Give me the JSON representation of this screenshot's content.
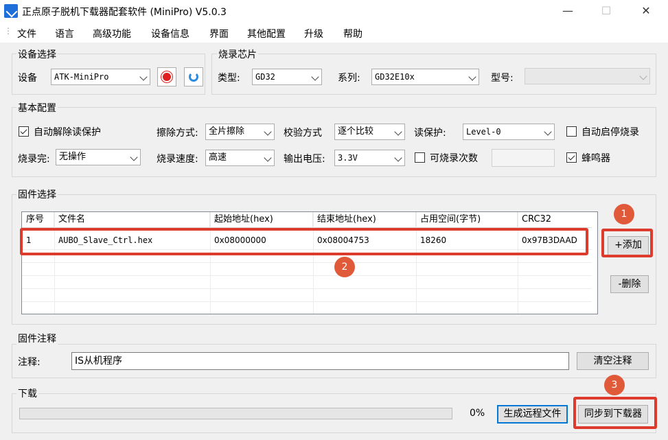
{
  "window": {
    "title": "正点原子脱机下载器配套软件 (MiniPro)  V5.0.3",
    "minimize": "—",
    "maximize": "☐",
    "close": "✕"
  },
  "menu": [
    "文件",
    "语言",
    "高级功能",
    "设备信息",
    "界面",
    "其他配置",
    "升级",
    "帮助"
  ],
  "device_select": {
    "title": "设备选择",
    "device_label": "设备",
    "device_value": "ATK-MiniPro"
  },
  "chip": {
    "title": "烧录芯片",
    "type_label": "类型:",
    "type_value": "GD32",
    "series_label": "系列:",
    "series_value": "GD32E10x",
    "model_label": "型号:",
    "model_value": ""
  },
  "basic": {
    "title": "基本配置",
    "auto_unprotect": "自动解除读保护",
    "erase_label": "擦除方式:",
    "erase_value": "全片擦除",
    "verify_label": "校验方式",
    "verify_value": "逐个比较",
    "readprot_label": "读保护:",
    "readprot_value": "Level-0",
    "auto_start": "自动启停烧录",
    "finish_label": "烧录完:",
    "finish_value": "无操作",
    "speed_label": "烧录速度:",
    "speed_value": "高速",
    "voltage_label": "输出电压:",
    "voltage_value": "3.3V",
    "count_label": "可烧录次数",
    "count_value": "",
    "buzzer": "蜂鸣器"
  },
  "firmware": {
    "title": "固件选择",
    "columns": [
      "序号",
      "文件名",
      "起始地址(hex)",
      "结束地址(hex)",
      "占用空间(字节)",
      "CRC32"
    ],
    "rows": [
      [
        "1",
        "AUBO_Slave_Ctrl.hex",
        "0x08000000",
        "0x08004753",
        "18260",
        "0x97B3DAAD"
      ]
    ],
    "add_button": "+添加",
    "delete_button": "-删除"
  },
  "note": {
    "title": "固件注释",
    "label": "注释:",
    "value": "IS从机程序",
    "clear_button": "清空注释"
  },
  "download": {
    "title": "下载",
    "progress": 0,
    "percent": "0%",
    "generate_button": "生成远程文件",
    "sync_button": "同步到下载器"
  },
  "annotations": [
    "1",
    "2",
    "3"
  ],
  "colors": {
    "highlight": "#dc3b2e",
    "badge": "#e05a3a",
    "focus": "#0078d7"
  }
}
